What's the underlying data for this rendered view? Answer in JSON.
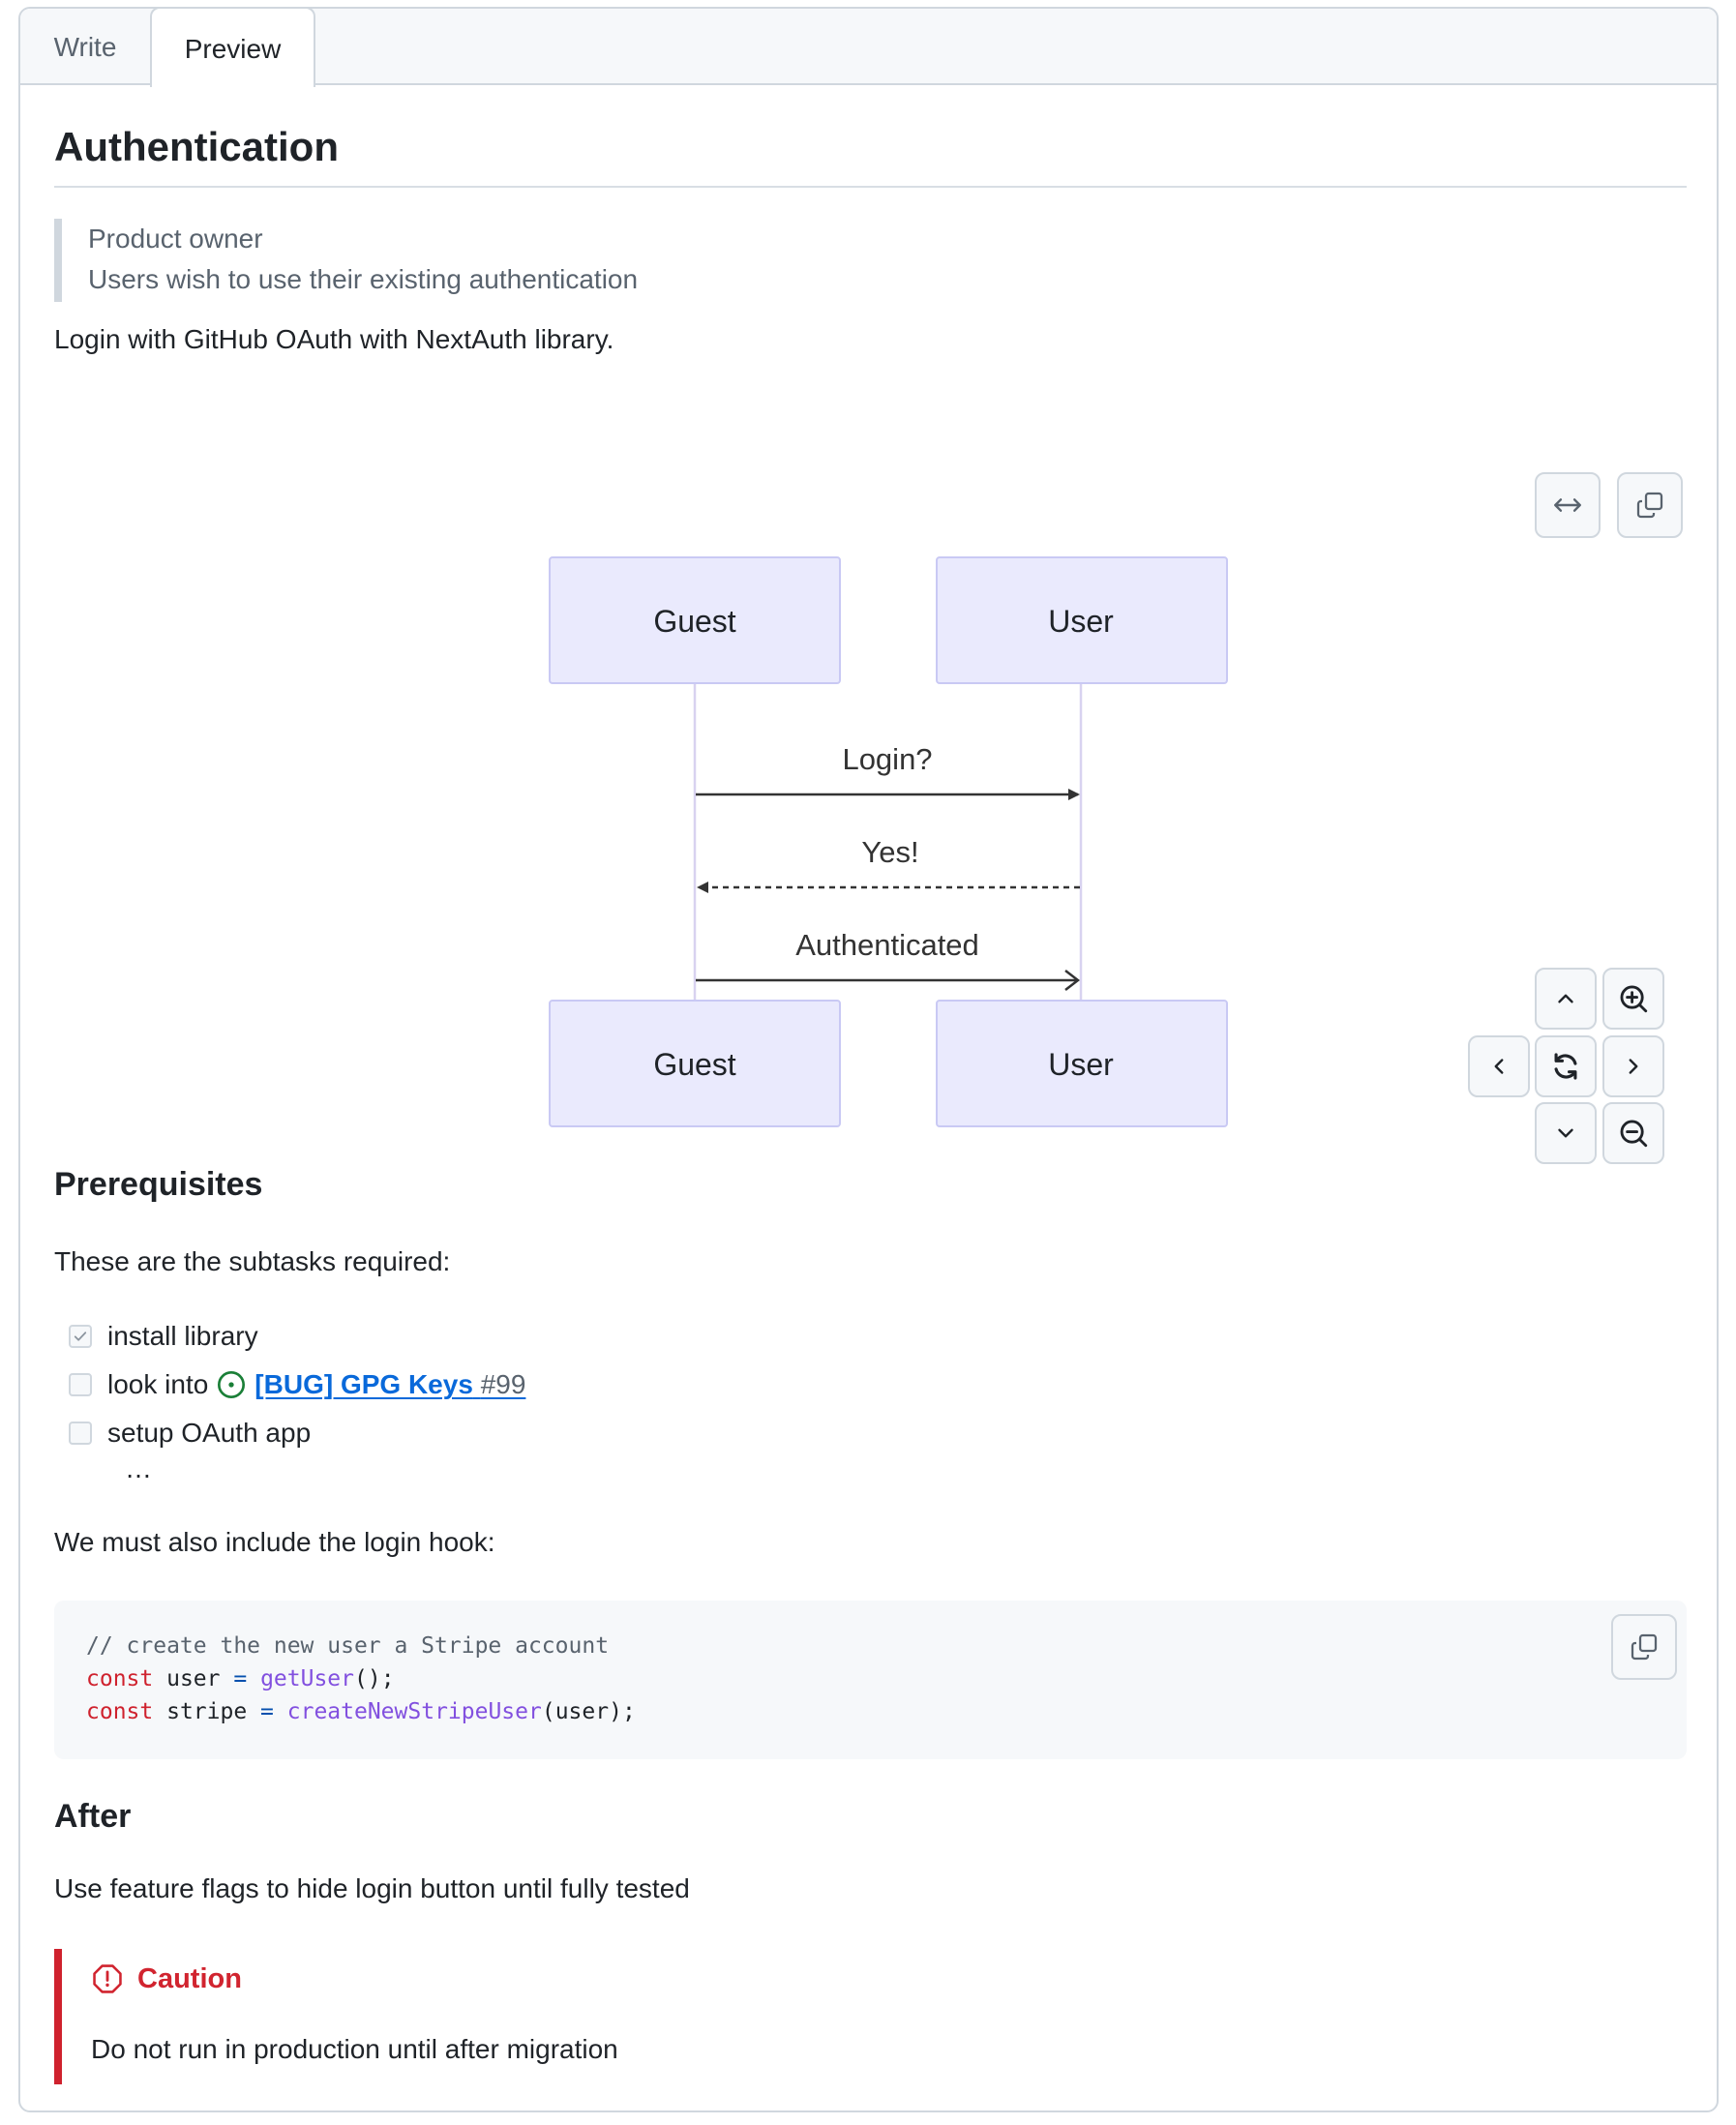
{
  "tabs": [
    {
      "label": "Write"
    },
    {
      "label": "Preview"
    }
  ],
  "doc": {
    "title": "Authentication",
    "quote": [
      "Product owner",
      "Users wish to use their existing authentication"
    ],
    "intro": "Login with GitHub OAuth with NextAuth library."
  },
  "diagram": {
    "actors": [
      "Guest",
      "User"
    ],
    "messages": [
      {
        "from": "Guest",
        "to": "User",
        "label": "Login?",
        "style": "solid"
      },
      {
        "from": "User",
        "to": "Guest",
        "label": "Yes!",
        "style": "dotted"
      },
      {
        "from": "Guest",
        "to": "User",
        "label": "Authenticated",
        "style": "open-arrow"
      }
    ],
    "colors": {
      "actor_fill": "#eaeafd",
      "actor_border": "#c9c9f4",
      "lifeline": "#d8d2f0",
      "arrow": "#333333"
    },
    "controls": {
      "expand": "arrows-horizontal-icon",
      "copy": "copy-icon",
      "pan": [
        "chevron-up-icon",
        "chevron-left-icon",
        "chevron-right-icon",
        "chevron-down-icon"
      ],
      "zoom": [
        "zoom-in-icon",
        "zoom-out-icon"
      ],
      "reset": "refresh-icon"
    }
  },
  "prerequisites": {
    "heading": "Prerequisites",
    "intro": "These are the subtasks required:",
    "tasks": [
      {
        "label": "install library",
        "checked": true
      },
      {
        "label": "look into",
        "checked": false,
        "issue_title": "[BUG] GPG Keys",
        "issue_number": "#99"
      },
      {
        "label": "setup OAuth app",
        "checked": false
      }
    ],
    "ellipsis": "…",
    "hook_text": "We must also include the login hook:"
  },
  "code": {
    "lines": [
      [
        {
          "t": "// create the new user a Stripe account",
          "k": "comment"
        }
      ],
      [
        {
          "t": "const",
          "k": "kw"
        },
        {
          "t": " user ",
          "k": ""
        },
        {
          "t": "=",
          "k": "op"
        },
        {
          "t": " ",
          "k": ""
        },
        {
          "t": "getUser",
          "k": "fn"
        },
        {
          "t": "();",
          "k": ""
        }
      ],
      [
        {
          "t": "const",
          "k": "kw"
        },
        {
          "t": " stripe ",
          "k": ""
        },
        {
          "t": "=",
          "k": "op"
        },
        {
          "t": " ",
          "k": ""
        },
        {
          "t": "createNewStripeUser",
          "k": "fn"
        },
        {
          "t": "(user);",
          "k": ""
        }
      ]
    ]
  },
  "after": {
    "heading": "After",
    "text": "Use feature flags to hide login button until fully tested",
    "caution_title": "Caution",
    "caution_body": "Do not run in production until after migration",
    "caution_color": "#d1242f"
  }
}
